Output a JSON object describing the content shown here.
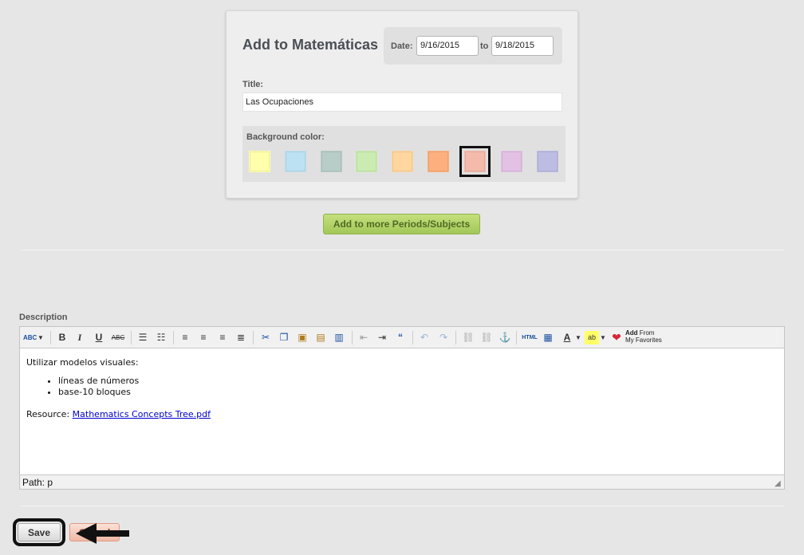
{
  "card": {
    "title": "Add to Matemáticas",
    "date_label": "Date:",
    "date_from": "9/16/2015",
    "date_to_label": "to",
    "date_to": "9/18/2015",
    "title_label": "Title:",
    "title_value": "Las Ocupaciones",
    "bg_label": "Background color:",
    "swatches": [
      "#ffffb3",
      "#bfe0f0",
      "#b9ccc8",
      "#ccebb5",
      "#fdd7a4",
      "#f7b184",
      "#f0bbae",
      "#e0c2e2",
      "#bdbde0"
    ],
    "selected_swatch": 6
  },
  "more_button": "Add to more Periods/Subjects",
  "description": {
    "label": "Description",
    "toolbar": {
      "add_from": "Add",
      "add_from_2": "From",
      "my_favorites": "My Favorites",
      "html": "HTML"
    },
    "content": {
      "intro": "Utilizar modelos visuales:",
      "items": [
        "líneas de números",
        "base-10 bloques"
      ],
      "resource_label": "Resource:",
      "resource_link": "Mathematics Concepts Tree.pdf"
    },
    "path": "Path: p"
  },
  "footer": {
    "save": "Save",
    "cancel": "Cancel"
  }
}
